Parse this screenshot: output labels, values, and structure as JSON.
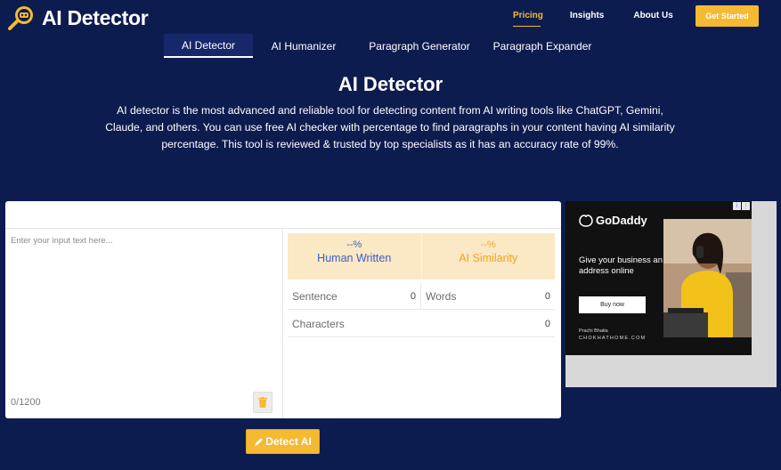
{
  "brand": {
    "name": "AI Detector"
  },
  "nav": {
    "items": [
      {
        "label": "Pricing",
        "active": true
      },
      {
        "label": "Insights",
        "active": false
      },
      {
        "label": "About Us",
        "active": false
      }
    ],
    "cta_label": "Get Started"
  },
  "tabs": [
    {
      "label": "AI Detector",
      "active": true
    },
    {
      "label": "AI Humanizer",
      "active": false
    },
    {
      "label": "Paragraph Generator",
      "active": false
    },
    {
      "label": "Paragraph Expander",
      "active": false
    }
  ],
  "hero": {
    "title": "AI Detector",
    "description": "AI detector is the most advanced and reliable tool for detecting content from AI writing tools like ChatGPT, Gemini, Claude, and others. You can use free AI checker with percentage to find paragraphs in your content having AI similarity percentage. This tool is reviewed & trusted by top specialists as it has an accuracy rate of 99%."
  },
  "editor": {
    "placeholder": "Enter your input text here...",
    "counter": "0/1200",
    "detect_label": "Detect AI"
  },
  "results": {
    "human": {
      "value": "--%",
      "label": "Human Written"
    },
    "ai": {
      "value": "--%",
      "label": "AI Similarity"
    },
    "sentence": {
      "label": "Sentence",
      "value": "0"
    },
    "words": {
      "label": "Words",
      "value": "0"
    },
    "characters": {
      "label": "Characters",
      "value": "0"
    }
  },
  "ad": {
    "brand": "GoDaddy",
    "headline": "Give your business an address online",
    "button": "Buy now",
    "person": "Prachi Bhatia",
    "site": "CHOKHATHOME.COM"
  },
  "colors": {
    "background": "#0d1c4f",
    "accent": "#f5b932",
    "human": "#3a5ec9",
    "ai": "#f0a420"
  }
}
